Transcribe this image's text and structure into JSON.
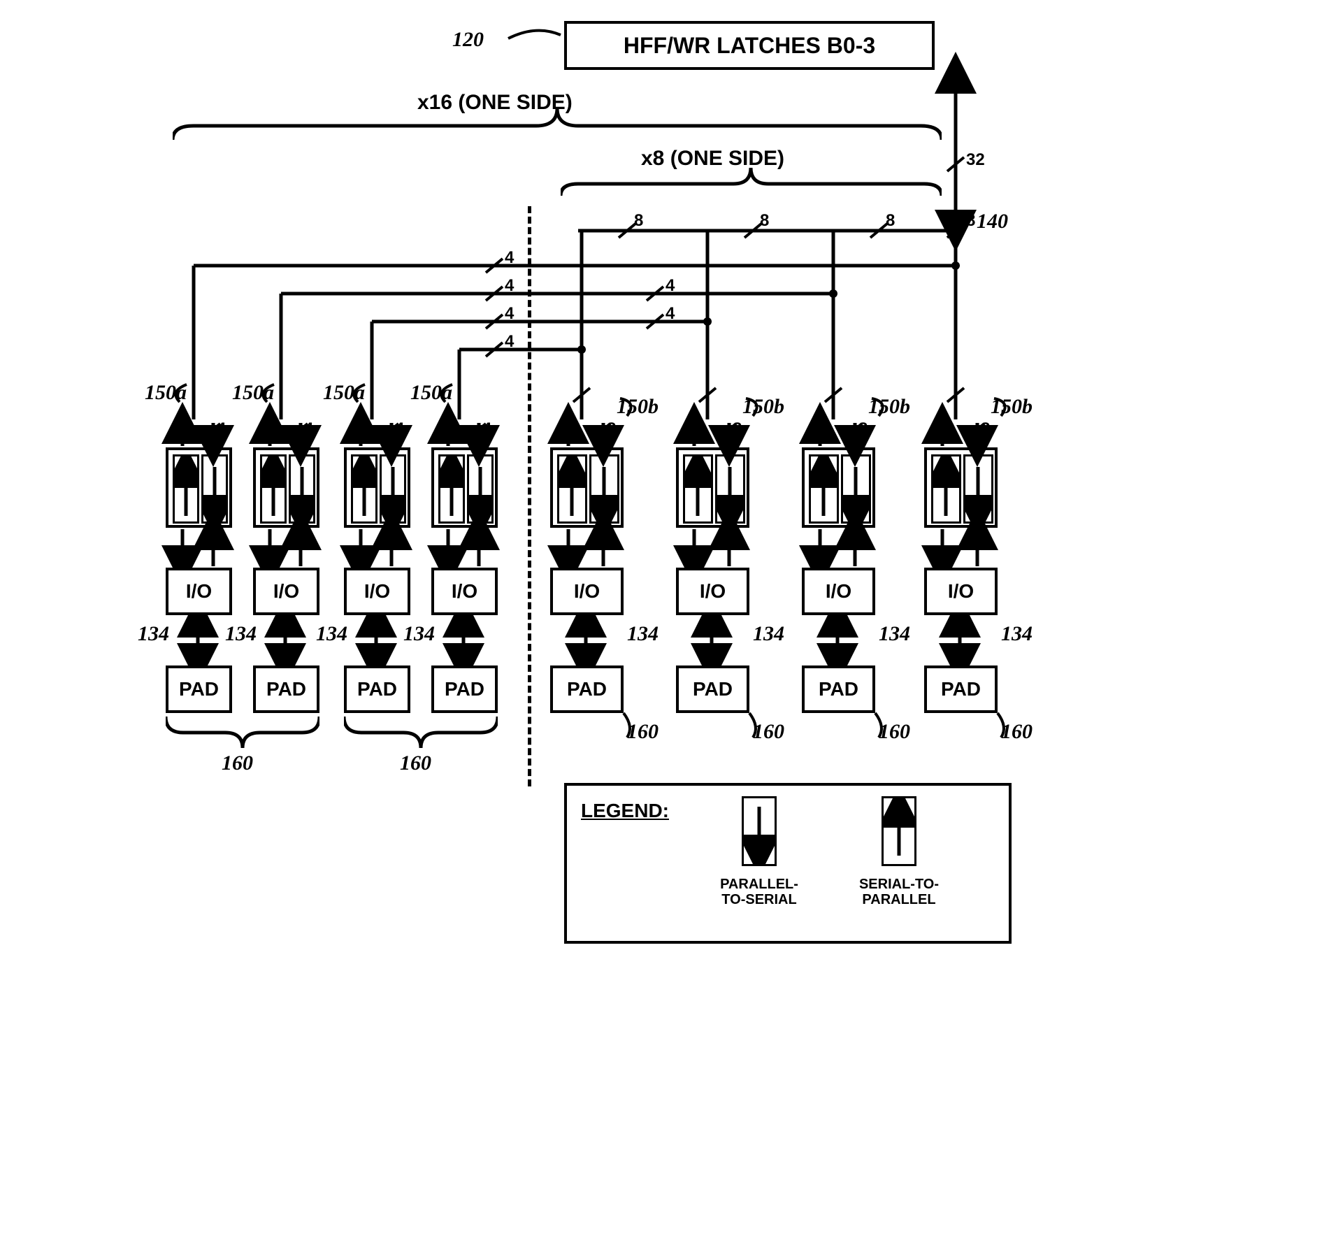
{
  "top_block": {
    "ref": "120",
    "label": "HFF/WR LATCHES B0-3"
  },
  "brace_x16": "x16 (ONE SIDE)",
  "brace_x8": "x8 (ONE SIDE)",
  "bus_main": {
    "width": "32",
    "ref": "140"
  },
  "left_bus_widths": [
    "4",
    "4",
    "4",
    "4"
  ],
  "right_bus_widths": [
    "8",
    "8",
    "8",
    "8"
  ],
  "channels": [
    {
      "ref": "150a",
      "top_in": "4",
      "top_out": "4",
      "io_ref": "134",
      "pad_ref": "160",
      "pad": "PAD",
      "io": "I/O"
    },
    {
      "ref": "150a",
      "top_in": "4",
      "top_out": "4",
      "io_ref": "134",
      "pad_ref": "160",
      "pad": "PAD",
      "io": "I/O"
    },
    {
      "ref": "150a",
      "top_in": "4",
      "top_out": "4",
      "io_ref": "134",
      "pad_ref": "160",
      "pad": "PAD",
      "io": "I/O"
    },
    {
      "ref": "150a",
      "top_in": "4",
      "top_out": "4",
      "io_ref": "134",
      "pad_ref": "160",
      "pad": "PAD",
      "io": "I/O"
    },
    {
      "ref": "150b",
      "top_in": "8",
      "top_out": "8",
      "io_ref": "134",
      "pad_ref": "160",
      "pad": "PAD",
      "io": "I/O"
    },
    {
      "ref": "150b",
      "top_in": "8",
      "top_out": "8",
      "io_ref": "134",
      "pad_ref": "160",
      "pad": "PAD",
      "io": "I/O"
    },
    {
      "ref": "150b",
      "top_in": "8",
      "top_out": "8",
      "io_ref": "134",
      "pad_ref": "160",
      "pad": "PAD",
      "io": "I/O"
    },
    {
      "ref": "150b",
      "top_in": "8",
      "top_out": "8",
      "io_ref": "134",
      "pad_ref": "160",
      "pad": "PAD",
      "io": "I/O"
    }
  ],
  "legend": {
    "title": "LEGEND:",
    "parallel_to_serial": "PARALLEL-\nTO-SERIAL",
    "serial_to_parallel": "SERIAL-TO-\nPARALLEL"
  },
  "extra_4s": [
    "4",
    "4"
  ]
}
